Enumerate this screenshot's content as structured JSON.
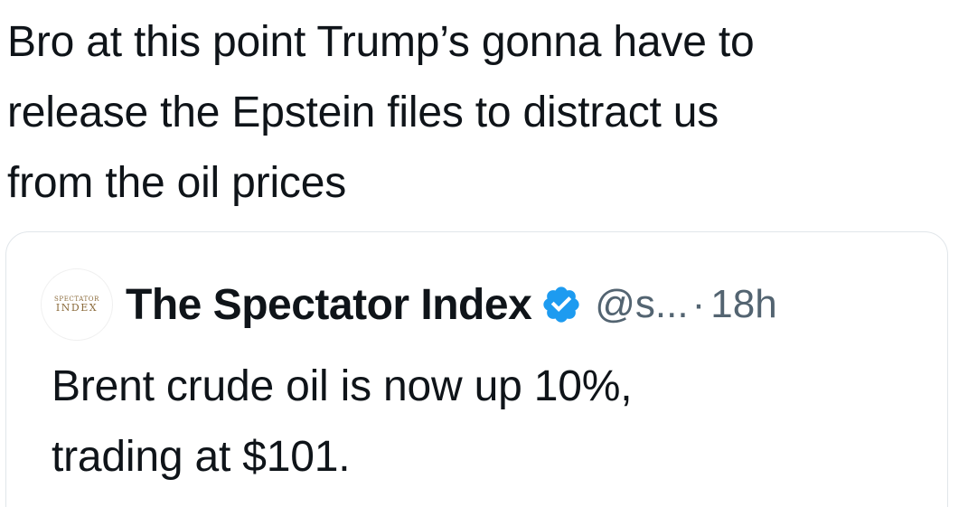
{
  "tweet": {
    "lines": [
      "Bro at this point Trump’s gonna have to",
      "release the Epstein files to distract us",
      "from the oil prices"
    ]
  },
  "quote": {
    "avatar": {
      "logo_top": "SPECTATOR",
      "logo_bottom": "INDEX",
      "icon": "spectator-index-logo"
    },
    "display_name": "The Spectator Index",
    "verified_icon": "verified-badge-icon",
    "handle": "@s...",
    "separator": "·",
    "time": "18h",
    "lines": [
      "Brent crude oil is now up 10%,",
      "trading at $101."
    ]
  },
  "colors": {
    "text": "#0f1419",
    "secondary_text": "#536471",
    "verified": "#1d9bf0",
    "card_border": "#e1e6ea",
    "logo": "#8a6a3a"
  }
}
